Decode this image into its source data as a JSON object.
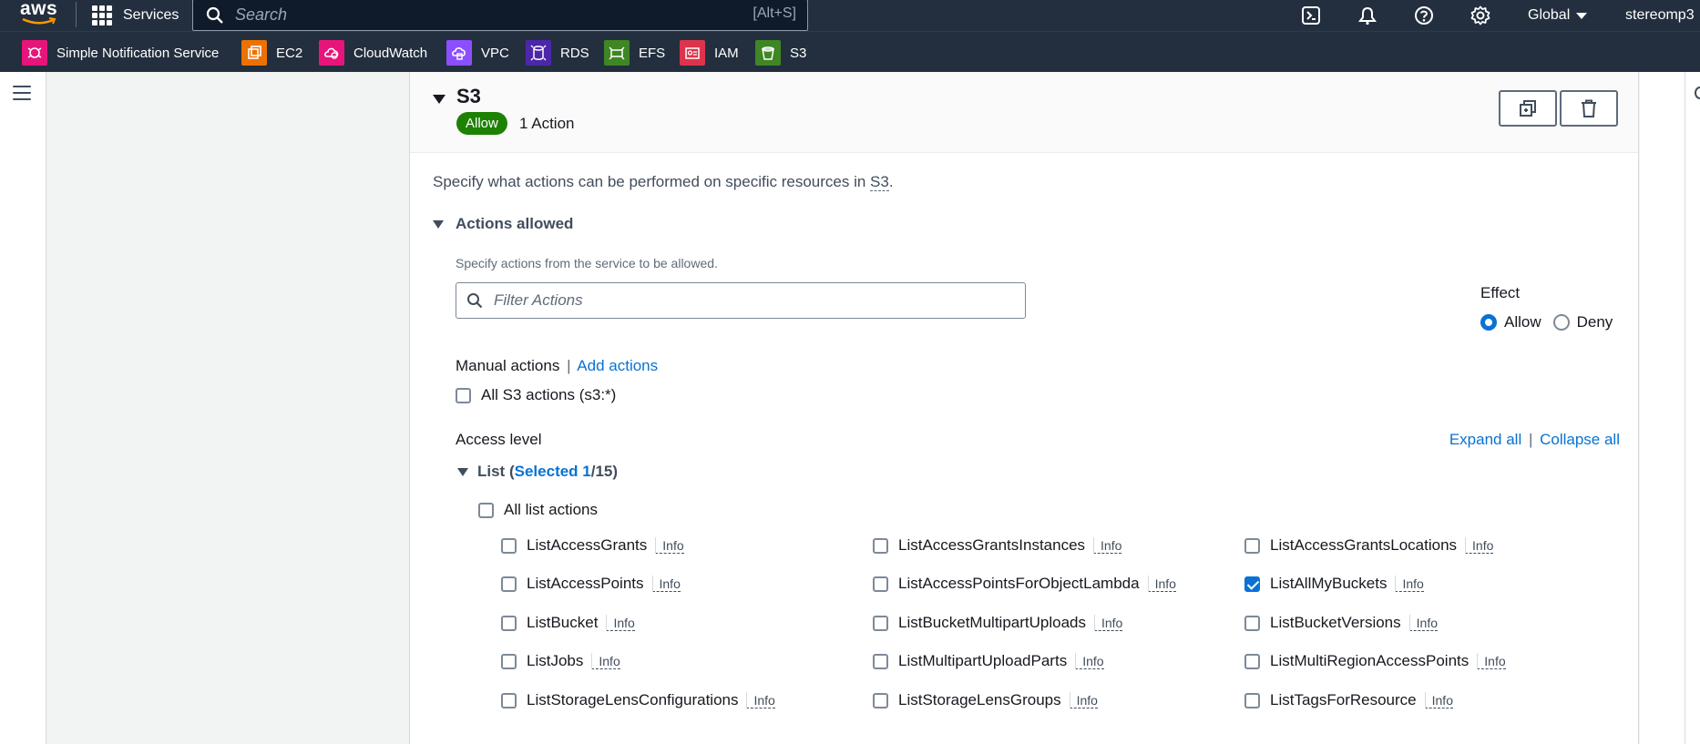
{
  "topbar": {
    "logo_text": "aws",
    "services_label": "Services",
    "search_placeholder": "Search",
    "search_shortcut": "[Alt+S]",
    "region_label": "Global",
    "user_label": "stereomp3"
  },
  "favorites": [
    {
      "label": "Simple Notification Service",
      "icon": "sns-icon",
      "color": "#e7157b"
    },
    {
      "label": "EC2",
      "icon": "ec2-icon",
      "color": "#ed7100"
    },
    {
      "label": "CloudWatch",
      "icon": "cloudwatch-icon",
      "color": "#e7157b"
    },
    {
      "label": "VPC",
      "icon": "vpc-icon",
      "color": "#8c4fff"
    },
    {
      "label": "RDS",
      "icon": "rds-icon",
      "color": "#4d27aa"
    },
    {
      "label": "EFS",
      "icon": "efs-icon",
      "color": "#3f8624"
    },
    {
      "label": "IAM",
      "icon": "iam-icon",
      "color": "#dd344c"
    },
    {
      "label": "S3",
      "icon": "s3-icon",
      "color": "#3f8624"
    }
  ],
  "section": {
    "title": "S3",
    "effect_badge": "Allow",
    "action_count": "1 Action",
    "description_prefix": "Specify what actions can be performed on specific resources in ",
    "description_service": "S3",
    "description_suffix": ".",
    "actions_allowed_heading": "Actions allowed",
    "actions_hint": "Specify actions from the service to be allowed.",
    "filter_placeholder": "Filter Actions",
    "effect_label": "Effect",
    "effect_allow": "Allow",
    "effect_deny": "Deny",
    "manual_actions": "Manual actions",
    "divider": "|",
    "add_actions": "Add actions",
    "all_actions_label": "All S3 actions (s3:*)",
    "access_level": "Access level",
    "expand_all": "Expand all",
    "collapse_all": "Collapse all"
  },
  "list_group": {
    "name": "List",
    "open_paren": "(",
    "selected_label": "Selected 1",
    "total": "/15)",
    "all_label": "All list actions"
  },
  "actions": [
    {
      "label": "ListAccessGrants",
      "info": "Info",
      "checked": false
    },
    {
      "label": "ListAccessGrantsInstances",
      "info": "Info",
      "checked": false
    },
    {
      "label": "ListAccessGrantsLocations",
      "info": "Info",
      "checked": false
    },
    {
      "label": "ListAccessPoints",
      "info": "Info",
      "checked": false
    },
    {
      "label": "ListAccessPointsForObjectLambda",
      "info": "Info",
      "checked": false
    },
    {
      "label": "ListAllMyBuckets",
      "info": "Info",
      "checked": true
    },
    {
      "label": "ListBucket",
      "info": "Info",
      "checked": false
    },
    {
      "label": "ListBucketMultipartUploads",
      "info": "Info",
      "checked": false
    },
    {
      "label": "ListBucketVersions",
      "info": "Info",
      "checked": false
    },
    {
      "label": "ListJobs",
      "info": "Info",
      "checked": false
    },
    {
      "label": "ListMultipartUploadParts",
      "info": "Info",
      "checked": false
    },
    {
      "label": "ListMultiRegionAccessPoints",
      "info": "Info",
      "checked": false
    },
    {
      "label": "ListStorageLensConfigurations",
      "info": "Info",
      "checked": false
    },
    {
      "label": "ListStorageLensGroups",
      "info": "Info",
      "checked": false
    },
    {
      "label": "ListTagsForResource",
      "info": "Info",
      "checked": false
    }
  ]
}
